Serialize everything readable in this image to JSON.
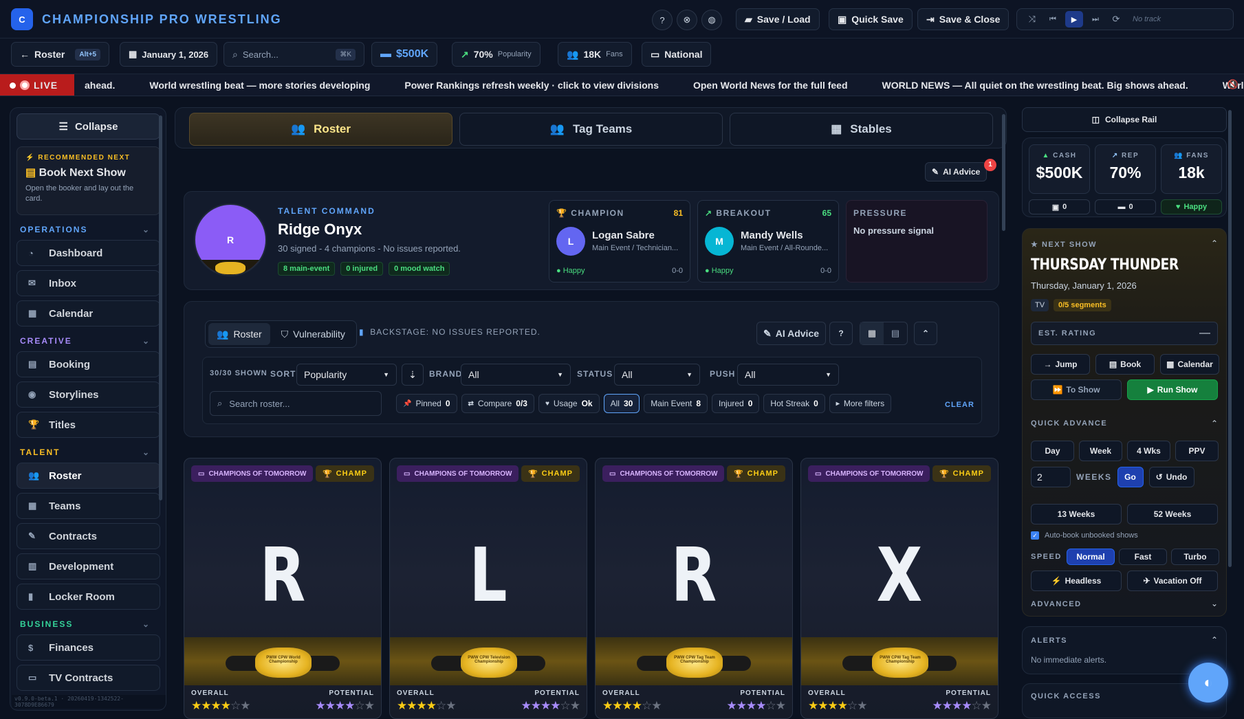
{
  "app": {
    "logo_letter": "C",
    "title": "CHAMPIONSHIP PRO WRESTLING"
  },
  "toolbar": {
    "save_load": "Save / Load",
    "quick_save": "Quick Save",
    "save_close": "Save & Close",
    "track": "No track"
  },
  "row2": {
    "back": "Roster",
    "shortcut": "Alt+5",
    "date": "January 1, 2026",
    "search_placeholder": "Search...",
    "search_kbd": "⌘K",
    "cash": "$500K",
    "pop_value": "70%",
    "pop_label": "Popularity",
    "fans_value": "18K",
    "fans_label": "Fans",
    "reach": "National"
  },
  "ticker": {
    "live": "LIVE",
    "items": [
      "ahead.",
      "World wrestling beat — more stories developing",
      "Power Rankings refresh weekly · click to view divisions",
      "Open World News for the full feed",
      "WORLD NEWS — All quiet on the wrestling beat. Big shows ahead.",
      "World"
    ]
  },
  "sidebar": {
    "collapse": "Collapse",
    "rec_label": "RECOMMENDED NEXT",
    "rec_title": "Book Next Show",
    "rec_desc": "Open the booker and lay out the card.",
    "sections": [
      {
        "label": "OPERATIONS",
        "color": "#60a5fa",
        "items": [
          "Dashboard",
          "Inbox",
          "Calendar"
        ]
      },
      {
        "label": "CREATIVE",
        "color": "#a78bfa",
        "items": [
          "Booking",
          "Storylines",
          "Titles"
        ]
      },
      {
        "label": "TALENT",
        "color": "#fbbf24",
        "items": [
          "Roster",
          "Teams",
          "Contracts",
          "Development",
          "Locker Room"
        ]
      },
      {
        "label": "BUSINESS",
        "color": "#34d399",
        "items": [
          "Finances",
          "TV Contracts"
        ]
      }
    ],
    "version": "v0.9.0-beta.1 · 20260419-1342522-3078D9E86679"
  },
  "tabs": [
    "Roster",
    "Tag Teams",
    "Stables"
  ],
  "ai_advice": {
    "label": "AI Advice",
    "badge": "1"
  },
  "command": {
    "avatar_letter": "R",
    "eyebrow": "TALENT COMMAND",
    "name": "Ridge Onyx",
    "summary": "30 signed - 4 champions - No issues reported.",
    "badges": [
      "8 main-event",
      "0 injured",
      "0 mood watch"
    ],
    "champion": {
      "label": "CHAMPION",
      "score": "81",
      "letter": "L",
      "name": "Logan Sabre",
      "role": "Main Event / Technician...",
      "mood": "Happy",
      "record": "0-0"
    },
    "breakout": {
      "label": "BREAKOUT",
      "score": "65",
      "letter": "M",
      "name": "Mandy Wells",
      "role": "Main Event / All-Rounde...",
      "mood": "Happy",
      "record": "0-0"
    },
    "pressure": {
      "label": "PRESSURE",
      "text": "No pressure signal"
    }
  },
  "filters": {
    "seg": [
      "Roster",
      "Vulnerability"
    ],
    "backstage": "BACKSTAGE: NO ISSUES REPORTED.",
    "ai_advice": "AI Advice",
    "shown": "30/30 SHOWN",
    "sort_label": "SORT",
    "sort_value": "Popularity",
    "brand_label": "BRAND",
    "brand_value": "All",
    "status_label": "STATUS",
    "status_value": "All",
    "push_label": "PUSH",
    "push_value": "All",
    "search_placeholder": "Search roster...",
    "chips": [
      {
        "label": "Pinned",
        "value": "0"
      },
      {
        "label": "Compare",
        "value": "0/3"
      },
      {
        "label": "Usage",
        "value": "Ok"
      },
      {
        "label": "All",
        "value": "30"
      },
      {
        "label": "Main Event",
        "value": "8"
      },
      {
        "label": "Injured",
        "value": "0"
      },
      {
        "label": "Hot Streak",
        "value": "0"
      },
      {
        "label": "More filters",
        "value": ""
      }
    ],
    "clear": "CLEAR"
  },
  "wrestler_cards": [
    {
      "tag": "CHAMPIONS OF TOMORROW",
      "champ": "CHAMP",
      "letter": "R",
      "belt": "PWW CPW World Championship",
      "overall_label": "OVERALL",
      "potential_label": "POTENTIAL"
    },
    {
      "tag": "CHAMPIONS OF TOMORROW",
      "champ": "CHAMP",
      "letter": "L",
      "belt": "PWW CPW Television Championship",
      "overall_label": "OVERALL",
      "potential_label": "POTENTIAL"
    },
    {
      "tag": "CHAMPIONS OF TOMORROW",
      "champ": "CHAMP",
      "letter": "R",
      "belt": "PWW CPW Tag Team Championship",
      "overall_label": "OVERALL",
      "potential_label": "POTENTIAL"
    },
    {
      "tag": "CHAMPIONS OF TOMORROW",
      "champ": "CHAMP",
      "letter": "X",
      "belt": "PWW CPW Tag Team Championship",
      "overall_label": "OVERALL",
      "potential_label": "POTENTIAL"
    }
  ],
  "rail": {
    "collapse": "Collapse Rail",
    "stats": [
      {
        "label": "CASH",
        "value": "$500K"
      },
      {
        "label": "REP",
        "value": "70%"
      },
      {
        "label": "FANS",
        "value": "18k"
      }
    ],
    "mini": [
      "0",
      "0",
      "Happy"
    ],
    "next_show": {
      "label": "NEXT SHOW",
      "title": "THURSDAY THUNDER",
      "date": "Thursday, January 1, 2026",
      "tv": "TV",
      "segments": "0/5 segments",
      "rating_label": "EST. RATING",
      "rating_value": "—"
    },
    "show_buttons": [
      "Jump",
      "Book",
      "Calendar"
    ],
    "to_show": "To Show",
    "run_show": "Run Show",
    "quick_advance": "QUICK ADVANCE",
    "advance_buttons": [
      "Day",
      "Week",
      "4 Wks",
      "PPV"
    ],
    "weeks_value": "2",
    "weeks_label": "WEEKS",
    "go": "Go",
    "undo": "Undo",
    "long_buttons": [
      "13 Weeks",
      "52 Weeks"
    ],
    "autobook": "Auto-book unbooked shows",
    "speed_label": "SPEED",
    "speeds": [
      "Normal",
      "Fast",
      "Turbo"
    ],
    "headless": "Headless",
    "vacation": "Vacation Off",
    "advanced": "ADVANCED",
    "alerts_label": "ALERTS",
    "alerts_text": "No immediate alerts.",
    "quick_access": "QUICK ACCESS"
  },
  "colors": {
    "accent_blue": "#3b82f6",
    "gold": "#fbbf24",
    "live_red": "#dc2626",
    "green": "#22c55e"
  }
}
